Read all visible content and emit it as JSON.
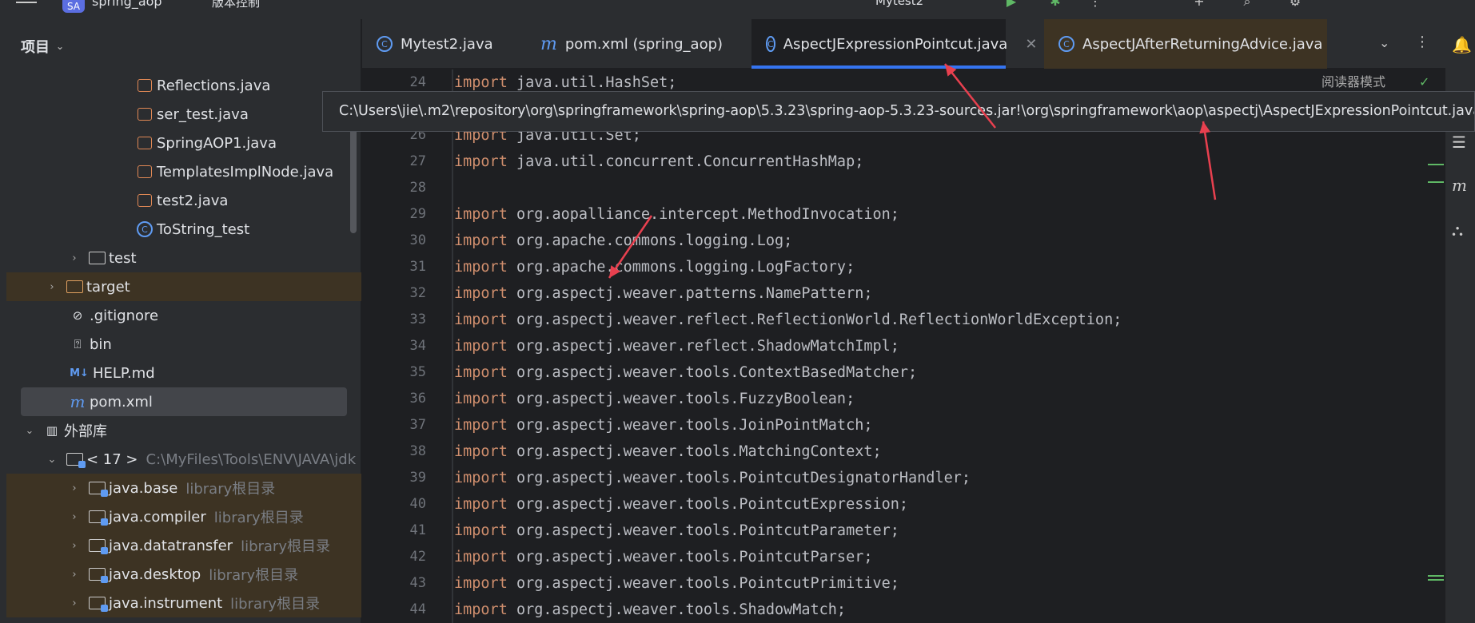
{
  "titlebar": {
    "project_badge": "SA",
    "project_name": "spring_aop",
    "vcs": "版本控制",
    "run_config": "Mytest2"
  },
  "sidebar": {
    "title": "项目",
    "items": [
      {
        "label": "Reflections.java",
        "hint": ""
      },
      {
        "label": "ser_test.java",
        "hint": ""
      },
      {
        "label": "SpringAOP1.java",
        "hint": ""
      },
      {
        "label": "TemplatesImplNode.java",
        "hint": ""
      },
      {
        "label": "test2.java",
        "hint": ""
      },
      {
        "label": "ToString_test",
        "hint": ""
      },
      {
        "label": "test",
        "hint": ""
      },
      {
        "label": "target",
        "hint": ""
      },
      {
        "label": ".gitignore",
        "hint": ""
      },
      {
        "label": "bin",
        "hint": ""
      },
      {
        "label": "HELP.md",
        "hint": ""
      },
      {
        "label": "pom.xml",
        "hint": ""
      },
      {
        "label": "外部库",
        "hint": ""
      },
      {
        "label": "< 17 >",
        "hint": "C:\\MyFiles\\Tools\\ENV\\JAVA\\jdk"
      },
      {
        "label": "java.base",
        "hint": "library根目录"
      },
      {
        "label": "java.compiler",
        "hint": "library根目录"
      },
      {
        "label": "java.datatransfer",
        "hint": "library根目录"
      },
      {
        "label": "java.desktop",
        "hint": "library根目录"
      },
      {
        "label": "java.instrument",
        "hint": "library根目录"
      }
    ]
  },
  "tabs": [
    {
      "label": "Mytest2.java"
    },
    {
      "label": "pom.xml (spring_aop)"
    },
    {
      "label": "AspectJExpressionPointcut.java"
    },
    {
      "label": "AspectJAfterReturningAdvice.java"
    }
  ],
  "editor": {
    "reader_mode": "阅读器模式",
    "lines": [
      {
        "n": "24",
        "kw": "import",
        "rest": " java.util.HashSet;"
      },
      {
        "n": "25",
        "kw": "",
        "rest": ""
      },
      {
        "n": "26",
        "kw": "import",
        "rest": " java.util.Set;"
      },
      {
        "n": "27",
        "kw": "import",
        "rest": " java.util.concurrent.ConcurrentHashMap;"
      },
      {
        "n": "28",
        "kw": "",
        "rest": ""
      },
      {
        "n": "29",
        "kw": "import",
        "rest": " org.aopalliance.intercept.MethodInvocation;"
      },
      {
        "n": "30",
        "kw": "import",
        "rest": " org.apache.commons.logging.Log;"
      },
      {
        "n": "31",
        "kw": "import",
        "rest": " org.apache.commons.logging.LogFactory;"
      },
      {
        "n": "32",
        "kw": "import",
        "rest": " org.aspectj.weaver.patterns.NamePattern;"
      },
      {
        "n": "33",
        "kw": "import",
        "rest": " org.aspectj.weaver.reflect.ReflectionWorld.ReflectionWorldException;"
      },
      {
        "n": "34",
        "kw": "import",
        "rest": " org.aspectj.weaver.reflect.ShadowMatchImpl;"
      },
      {
        "n": "35",
        "kw": "import",
        "rest": " org.aspectj.weaver.tools.ContextBasedMatcher;"
      },
      {
        "n": "36",
        "kw": "import",
        "rest": " org.aspectj.weaver.tools.FuzzyBoolean;"
      },
      {
        "n": "37",
        "kw": "import",
        "rest": " org.aspectj.weaver.tools.JoinPointMatch;"
      },
      {
        "n": "38",
        "kw": "import",
        "rest": " org.aspectj.weaver.tools.MatchingContext;"
      },
      {
        "n": "39",
        "kw": "import",
        "rest": " org.aspectj.weaver.tools.PointcutDesignatorHandler;"
      },
      {
        "n": "40",
        "kw": "import",
        "rest": " org.aspectj.weaver.tools.PointcutExpression;"
      },
      {
        "n": "41",
        "kw": "import",
        "rest": " org.aspectj.weaver.tools.PointcutParameter;"
      },
      {
        "n": "42",
        "kw": "import",
        "rest": " org.aspectj.weaver.tools.PointcutParser;"
      },
      {
        "n": "43",
        "kw": "import",
        "rest": " org.aspectj.weaver.tools.PointcutPrimitive;"
      },
      {
        "n": "44",
        "kw": "import",
        "rest": " org.aspectj.weaver.tools.ShadowMatch;"
      }
    ]
  },
  "tooltip": {
    "path": "C:\\Users\\jie\\.m2\\repository\\org\\springframework\\spring-aop\\5.3.23\\spring-aop-5.3.23-sources.jar!\\org\\springframework\\aop\\aspectj\\AspectJExpressionPointcut.java"
  },
  "colors": {
    "annotation_arrow": "#e8404f",
    "keyword": "#cf8e6d",
    "active_tab_underline": "#3574f0"
  }
}
